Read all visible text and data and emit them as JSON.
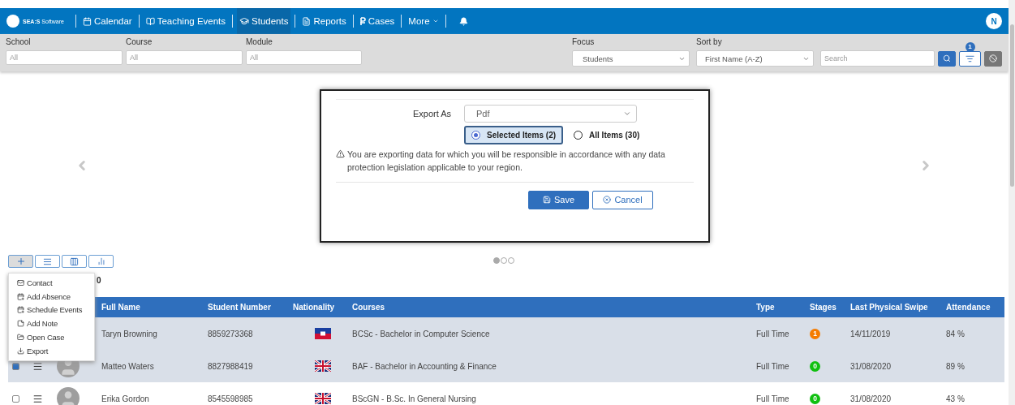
{
  "navbar": {
    "logo": "**SEA:S** Software",
    "items": [
      {
        "label": "Calendar",
        "kind": "calendar",
        "selected": false
      },
      {
        "label": "Teaching Events",
        "kind": "book",
        "selected": false
      },
      {
        "label": "Students",
        "kind": "cap",
        "selected": true
      },
      {
        "label": "Reports",
        "kind": "file",
        "selected": false
      },
      {
        "label": "Cases",
        "kind": "cases",
        "selected": false
      },
      {
        "label": "More",
        "kind": "more",
        "selected": false
      }
    ],
    "avatar": "N"
  },
  "filters": {
    "school": {
      "label": "School",
      "placeholder": "All"
    },
    "course": {
      "label": "Course",
      "placeholder": "All"
    },
    "module": {
      "label": "Module",
      "placeholder": "All"
    },
    "focus": {
      "label": "Focus",
      "value": "Students"
    },
    "sort": {
      "label": "Sort by",
      "value": "First Name (A-Z)"
    },
    "search": {
      "placeholder": "Search"
    },
    "filter_badge": "1"
  },
  "export_dialog": {
    "label": "Export As",
    "format": "Pdf",
    "options": [
      {
        "label": "Selected Items (2)",
        "selected": true
      },
      {
        "label": "All Items (30)",
        "selected": false
      }
    ],
    "warning": "You are exporting data for which you will be responsible in accordance with any data protection legislation applicable to your region.",
    "save": "Save",
    "cancel": "Cancel"
  },
  "carousel": {
    "dots": [
      {
        "selected": true
      },
      {
        "selected": false
      },
      {
        "selected": false
      }
    ]
  },
  "toolbar": [
    {
      "kind": "add",
      "selected": true
    },
    {
      "kind": "list",
      "selected": false
    },
    {
      "kind": "columns",
      "selected": false
    },
    {
      "kind": "chart",
      "selected": false
    }
  ],
  "add_menu": [
    {
      "label": "Contact",
      "kind": "mail"
    },
    {
      "label": "Add Absence",
      "kind": "calendar"
    },
    {
      "label": "Schedule Events",
      "kind": "calendar"
    },
    {
      "label": "Add Note",
      "kind": "note"
    },
    {
      "label": "Open Case",
      "kind": "folder"
    },
    {
      "label": "Export",
      "kind": "download"
    }
  ],
  "count": "0",
  "table": {
    "columns": [
      "Full Name",
      "Student Number",
      "Nationality",
      "Courses",
      "Type",
      "Stages",
      "Last Physical Swipe",
      "Attendance"
    ],
    "rows": [
      {
        "selected": true,
        "name": "Taryn Browning",
        "number": "8859273368",
        "flag": {
          "kind": "ht"
        },
        "course": "BCSc - Bachelor in Computer Science",
        "type": "Full Time",
        "stage": {
          "label": "1",
          "color": "#f57c00"
        },
        "swipe": "14/11/2019",
        "attendance": "84 %"
      },
      {
        "selected": true,
        "controls": {
          "checked": true
        },
        "name": "Matteo Waters",
        "number": "8827988419",
        "flag": {
          "kind": "gb"
        },
        "course": "BAF - Bachelor in Accounting & Finance",
        "type": "Full Time",
        "stage": {
          "label": "0",
          "color": "#10c010"
        },
        "swipe": "31/08/2020",
        "attendance": "89 %"
      },
      {
        "selected": false,
        "controls": {
          "checked": false
        },
        "name": "Erika Gordon",
        "number": "8545598985",
        "flag": {
          "kind": "gb"
        },
        "course": "BScGN - B.Sc. In General Nursing",
        "type": "Full Time",
        "stage": {
          "label": "0",
          "color": "#10c010"
        },
        "swipe": "31/08/2020",
        "attendance": "43 %"
      }
    ]
  }
}
